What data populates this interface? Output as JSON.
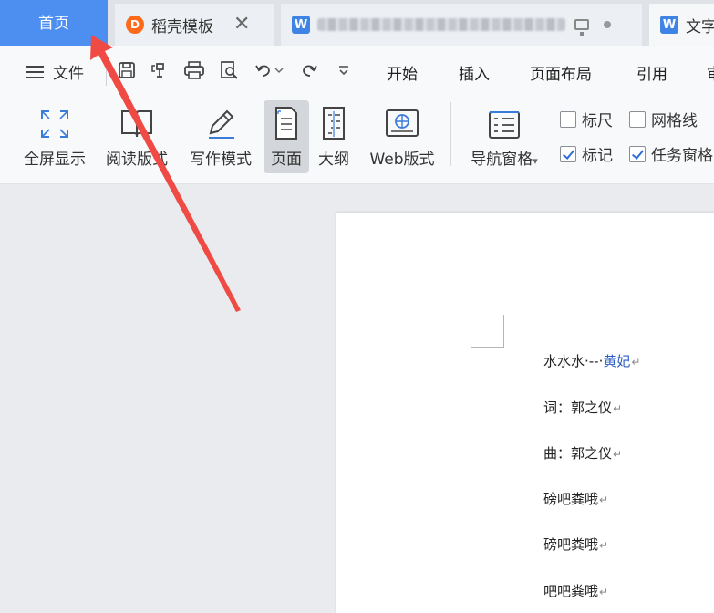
{
  "tabs": {
    "home": "首页",
    "template": "稻壳模板",
    "template_icon": "D",
    "doc_icon": "W",
    "current_icon": "W",
    "current_partial": "文字"
  },
  "menu": {
    "file": "文件",
    "start": "开始",
    "insert": "插入",
    "layout": "页面布局",
    "reference": "引用",
    "cut_partial": "审"
  },
  "view_buttons": {
    "fullscreen": "全屏显示",
    "reading": "阅读版式",
    "writing": "写作模式",
    "page": "页面",
    "outline": "大纲",
    "web": "Web版式",
    "nav": "导航窗格",
    "nav_caret": "▾",
    "web_icon_text": "⊕"
  },
  "checks": {
    "ruler": "标尺",
    "grid": "网格线",
    "mark": "标记",
    "taskpane": "任务窗格"
  },
  "document": {
    "l1a": "水水水·--·",
    "l1b": "黄妃",
    "l2": "词：郭之仪",
    "l3": "曲：郭之仪",
    "l4": "磅吧粪哦",
    "l5": "磅吧粪哦",
    "l6": "吧吧粪哦",
    "pilcrow": "↵"
  },
  "colors": {
    "accent": "#4c8ff0",
    "arrow": "#f04a45"
  }
}
